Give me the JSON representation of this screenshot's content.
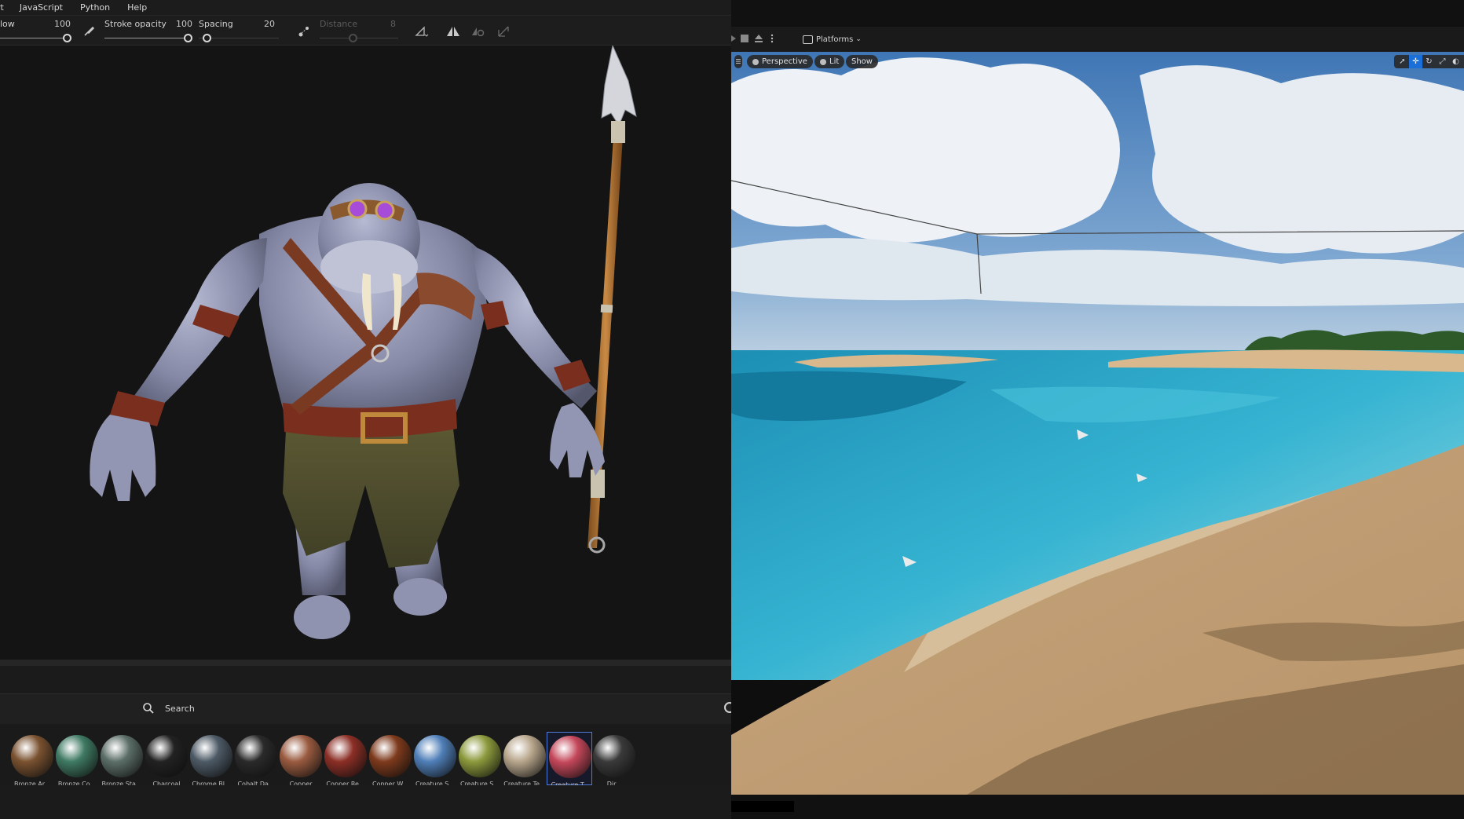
{
  "left_app": {
    "menu": [
      "rt",
      "JavaScript",
      "Python",
      "Help"
    ],
    "toolbar": {
      "flow_label": "low",
      "flow_value": "100",
      "stroke_opacity_label": "Stroke opacity",
      "stroke_opacity_value": "100",
      "spacing_label": "Spacing",
      "spacing_value": "20",
      "distance_label": "Distance",
      "distance_value": "8"
    },
    "search": {
      "placeholder": "Search"
    },
    "materials": [
      {
        "label": "Bronze Ar...",
        "color": "#7a5230"
      },
      {
        "label": "Bronze Co...",
        "color": "#3f7a63"
      },
      {
        "label": "Bronze Sta...",
        "color": "#5c6e68"
      },
      {
        "label": "Charcoal",
        "color": "#222222"
      },
      {
        "label": "Chrome Bl...",
        "color": "#4d5a66"
      },
      {
        "label": "Cobalt Da...",
        "color": "#2a2a2a"
      },
      {
        "label": "Copper",
        "color": "#9a5b40"
      },
      {
        "label": "Copper Re...",
        "color": "#8c2f26"
      },
      {
        "label": "Copper W...",
        "color": "#7e3a1c"
      },
      {
        "label": "Creature S...",
        "color": "#4f7fb8"
      },
      {
        "label": "Creature S...",
        "color": "#8c9a3c"
      },
      {
        "label": "Creature Te...",
        "color": "#b8a68c"
      },
      {
        "label": "Creature T...",
        "color": "#c4475a"
      },
      {
        "label": "Dir...",
        "color": "#3a3a3a"
      }
    ],
    "selected_material_index": 12
  },
  "right_app": {
    "toolbar": {
      "platforms_label": "Platforms"
    },
    "viewport": {
      "perspective_label": "Perspective",
      "lit_label": "Lit",
      "show_label": "Show"
    }
  }
}
